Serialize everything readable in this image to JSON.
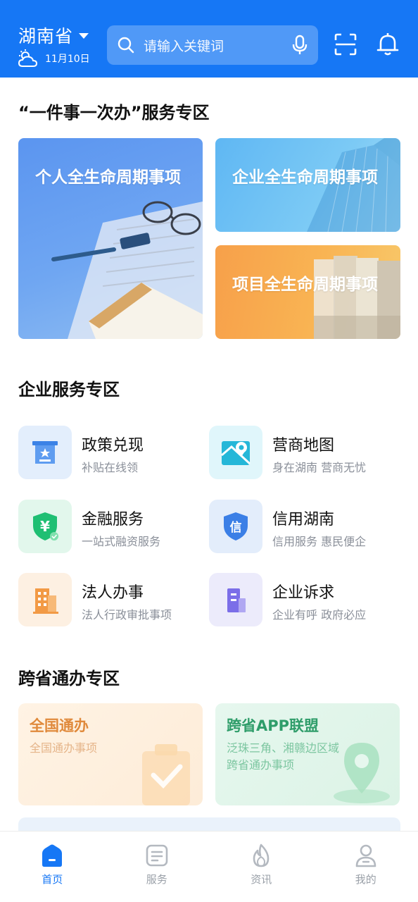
{
  "header": {
    "region": "湖南省",
    "date": "11月10日",
    "search_placeholder": "请输入关键词"
  },
  "sections": {
    "one_thing": "“一件事一次办”服务专区",
    "enterprise": "企业服务专区",
    "cross_province": "跨省通办专区"
  },
  "lifecycle_cards": [
    {
      "label": "个人全生命周期事项"
    },
    {
      "label": "企业全生命周期事项"
    },
    {
      "label": "项目全生命周期事项"
    }
  ],
  "services": [
    {
      "title": "政策兑现",
      "subtitle": "补贴在线领",
      "icon": "policy-award-icon"
    },
    {
      "title": "营商地图",
      "subtitle": "身在湖南 营商无忧",
      "icon": "map-pin-icon"
    },
    {
      "title": "金融服务",
      "subtitle": "一站式融资服务",
      "icon": "yuan-shield-icon"
    },
    {
      "title": "信用湖南",
      "subtitle": "信用服务 惠民便企",
      "icon": "credit-shield-icon"
    },
    {
      "title": "法人办事",
      "subtitle": "法人行政审批事项",
      "icon": "building-icon"
    },
    {
      "title": "企业诉求",
      "subtitle": "企业有呼 政府必应",
      "icon": "enterprise-building-icon"
    }
  ],
  "cross_cards": [
    {
      "title": "全国通办",
      "subtitle": "全国通办事项"
    },
    {
      "title": "跨省APP联盟",
      "subtitle": "泛珠三角、湘赣边区域跨省通办事项"
    }
  ],
  "bottom_nav": [
    {
      "label": "首页",
      "active": true
    },
    {
      "label": "服务",
      "active": false
    },
    {
      "label": "资讯",
      "active": false
    },
    {
      "label": "我的",
      "active": false
    }
  ],
  "colors": {
    "primary": "#1677f5",
    "orange_title": "#e08a3c",
    "green_title": "#2f9d6a"
  }
}
